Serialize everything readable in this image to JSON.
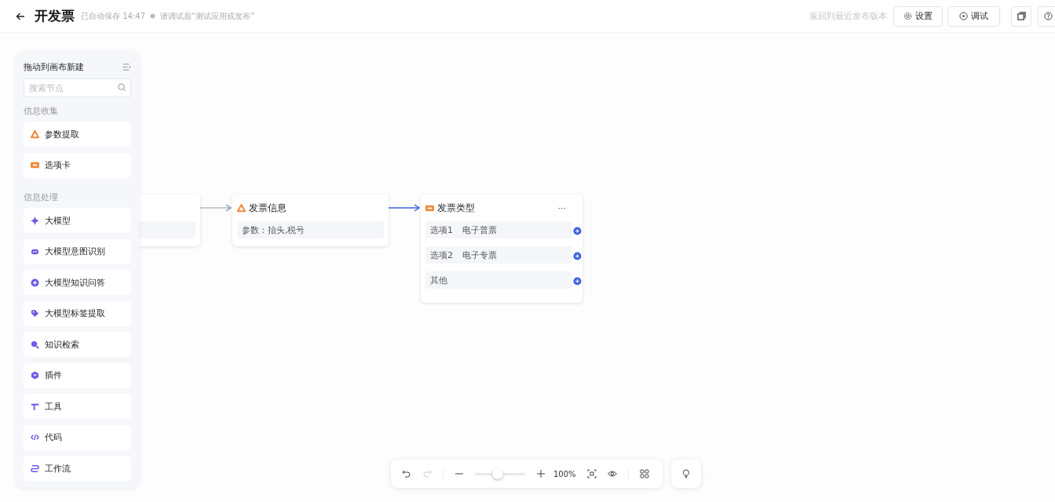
{
  "header": {
    "title": "开发票",
    "autosave": "已自动保存 14:47",
    "hint": "请调试后“测试应用或发布”",
    "revert_link": "返回到最近发布版本",
    "buttons": [
      {
        "label": "设置",
        "kind": "settings"
      },
      {
        "label": "调试",
        "kind": "debug"
      }
    ]
  },
  "palette": {
    "title": "拖动到画布新建",
    "search": {
      "placeholder": "搜索节点"
    },
    "groups": [
      {
        "label": "信息收集",
        "items": [
          {
            "label": "参数提取",
            "kind": "extract"
          },
          {
            "label": "选项卡",
            "kind": "options"
          }
        ]
      },
      {
        "label": "信息处理",
        "items": [
          {
            "label": "大模型",
            "kind": "llm"
          },
          {
            "label": "大模型意图识别",
            "kind": "intent"
          },
          {
            "label": "大模型知识问答",
            "kind": "qa"
          },
          {
            "label": "大模型标签提取",
            "kind": "tag"
          },
          {
            "label": "知识检索",
            "kind": "search"
          },
          {
            "label": "插件",
            "kind": "plugin"
          },
          {
            "label": "工具",
            "kind": "tool"
          },
          {
            "label": "代码",
            "kind": "code"
          },
          {
            "label": "工作流",
            "kind": "workflow"
          }
        ]
      }
    ]
  },
  "nodes": [
    {
      "kind": "partial"
    },
    {
      "kind": "extract",
      "title": "发票信息",
      "rows": [
        {
          "label": "参数：抬头,税号"
        }
      ]
    },
    {
      "kind": "options",
      "title": "发票类型",
      "more": "···",
      "rows": [
        {
          "label": "选项1",
          "value": "电子普票"
        },
        {
          "label": "选项2",
          "value": "电子专票"
        },
        {
          "label": "其他"
        }
      ]
    }
  ],
  "edges": [
    {
      "highlighted": false
    },
    {
      "highlighted": true
    }
  ],
  "toolbar": {
    "undo": {
      "disabled": false
    },
    "redo": {
      "disabled": true
    },
    "zoom": {
      "level": 0.45,
      "reading": "100%"
    }
  }
}
